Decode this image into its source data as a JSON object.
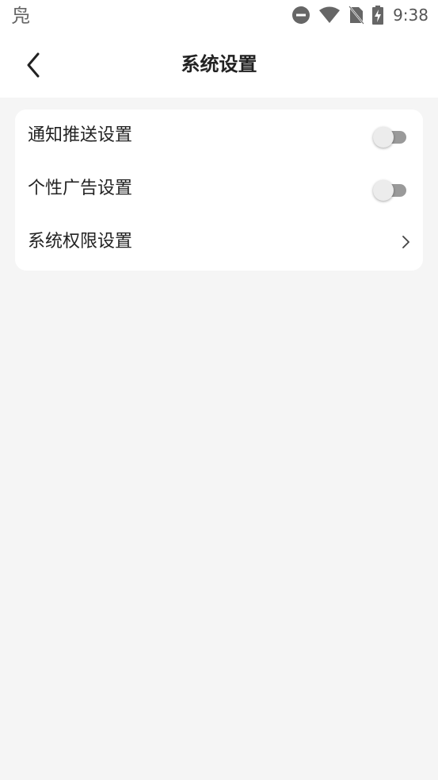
{
  "status_bar": {
    "app_glyph": "凫",
    "time": "9:38",
    "icons": [
      "do-not-disturb-icon",
      "wifi-icon",
      "no-sim-icon",
      "battery-charging-icon"
    ]
  },
  "header": {
    "title": "系统设置",
    "back_icon": "chevron-left-icon"
  },
  "settings": {
    "items": [
      {
        "label": "通知推送设置",
        "control": "toggle",
        "enabled": false
      },
      {
        "label": "个性广告设置",
        "control": "toggle",
        "enabled": false
      },
      {
        "label": "系统权限设置",
        "control": "chevron-right-icon"
      }
    ]
  },
  "colors": {
    "page_background": "#f5f5f5",
    "card_background": "#ffffff",
    "text": "#222222",
    "toggle_track_off": "#9a9a9a",
    "toggle_thumb_off": "#ececec"
  }
}
